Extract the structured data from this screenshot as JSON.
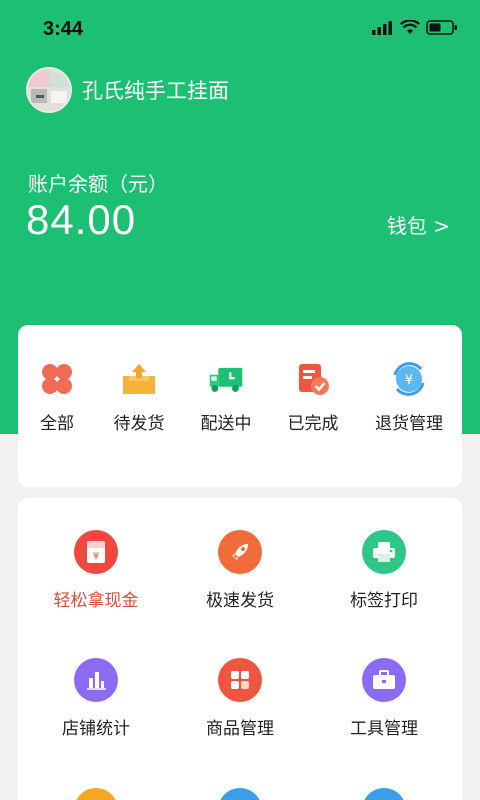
{
  "status": {
    "time": "3:44"
  },
  "shop": {
    "name": "孔氏纯手工挂面"
  },
  "balance": {
    "label": "账户余额（元）",
    "value": "84.00",
    "wallet_link": "钱包 >"
  },
  "orders": {
    "items": [
      {
        "label": "全部",
        "icon": "all-orders-icon"
      },
      {
        "label": "待发货",
        "icon": "pending-shipment-icon"
      },
      {
        "label": "配送中",
        "icon": "delivery-truck-icon"
      },
      {
        "label": "已完成",
        "icon": "completed-icon"
      },
      {
        "label": "退货管理",
        "icon": "refund-icon"
      }
    ]
  },
  "services": {
    "items": [
      {
        "label": "轻松拿现金",
        "icon": "red-envelope-icon",
        "color": "#f0483e"
      },
      {
        "label": "极速发货",
        "icon": "rocket-icon",
        "color": "#f26b3a"
      },
      {
        "label": "标签打印",
        "icon": "printer-icon",
        "color": "#2ec786"
      },
      {
        "label": "店铺统计",
        "icon": "bar-chart-icon",
        "color": "#8b6cf0"
      },
      {
        "label": "商品管理",
        "icon": "grid-icon",
        "color": "#f0553f"
      },
      {
        "label": "工具管理",
        "icon": "toolbox-icon",
        "color": "#8b6cf0"
      }
    ]
  },
  "colors": {
    "brand": "#1dbf73",
    "accent_red": "#e14b3b"
  }
}
